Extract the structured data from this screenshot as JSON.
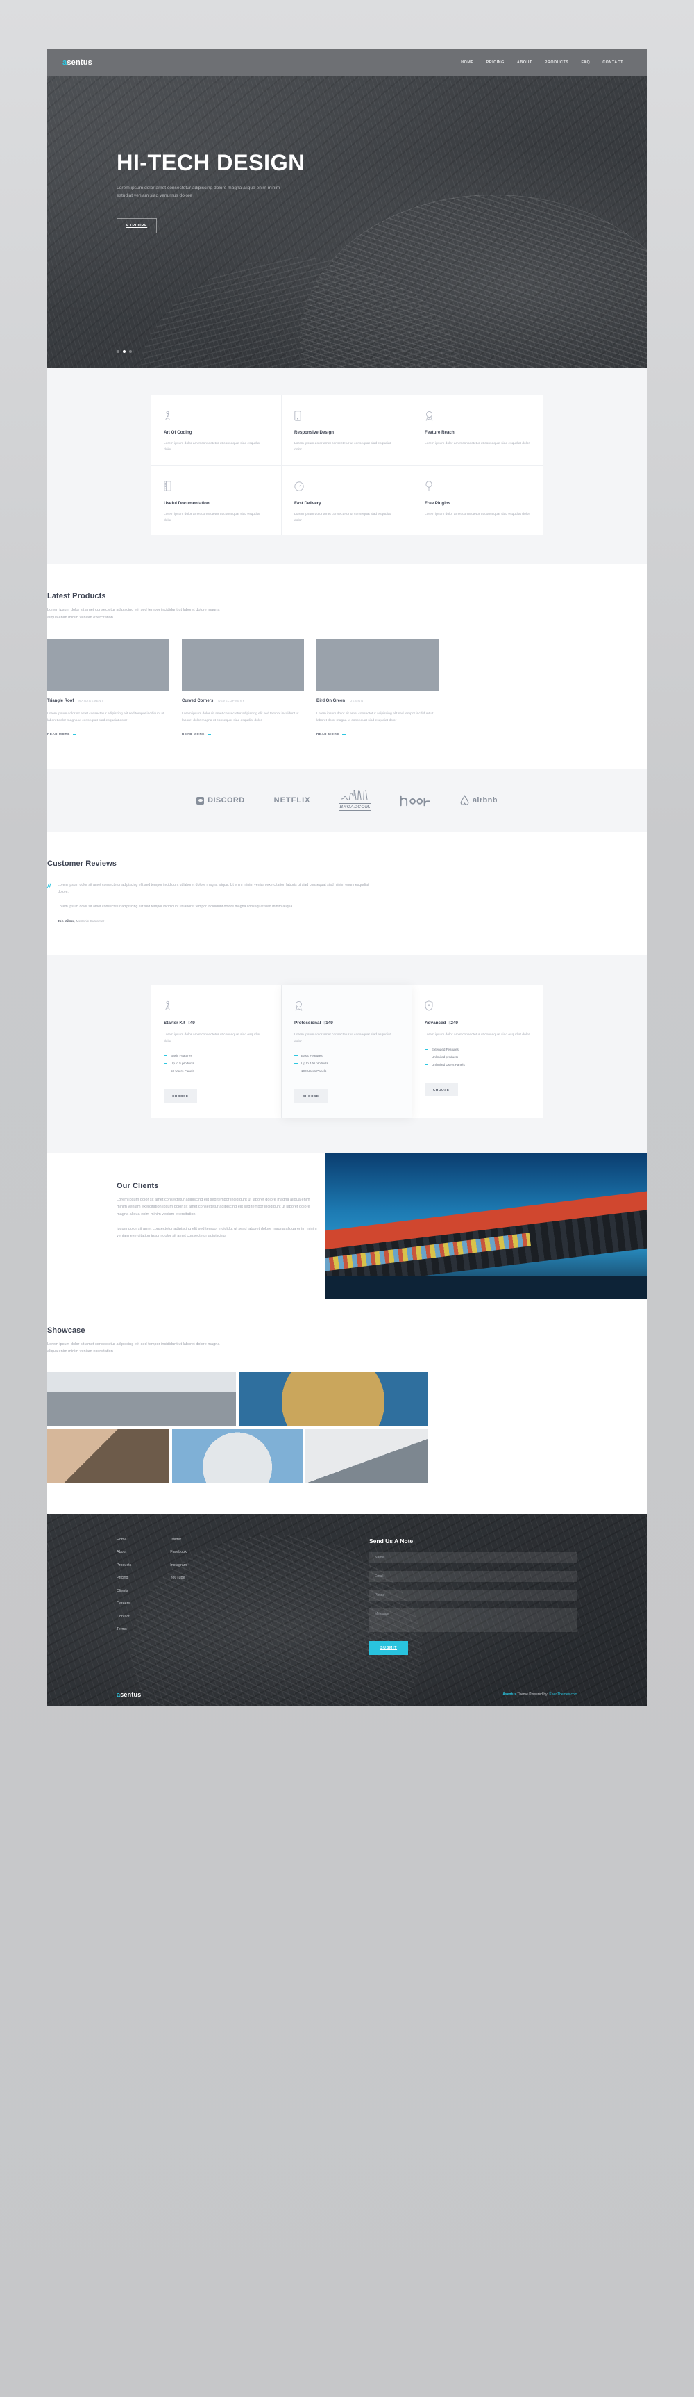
{
  "brand": {
    "prefix": "a",
    "name": "sentus",
    "accent": "#2ec6e0"
  },
  "nav": {
    "items": [
      "HOME",
      "PRICING",
      "ABOUT",
      "PRODUCTS",
      "FAQ",
      "CONTACT"
    ]
  },
  "hero": {
    "title": "HI-TECH DESIGN",
    "desc": "Lorem ipsum dolor amet consectetur adipiscing dolore magna aliqua enim minim estudiat veniam siad venumus dolore",
    "cta": "EXPLORE"
  },
  "features": [
    {
      "icon": "chess-pawn-icon",
      "title": "Art Of Coding",
      "desc": "Lorem ipsum dolor amet consectetur ut consequat siad esqudiat dolor"
    },
    {
      "icon": "mobile-icon",
      "title": "Responsive Design",
      "desc": "Lorem ipsum dolor amet consectetur ut consequat siad esqudiat dolor"
    },
    {
      "icon": "award-icon",
      "title": "Feature Reach",
      "desc": "Lorem ipsum dolor amet consectetur ut consequat siad esqudiat dolor"
    },
    {
      "icon": "book-icon",
      "title": "Useful Documentation",
      "desc": "Lorem ipsum dolor amet consectetur ut consequat siad esqudiat dolor"
    },
    {
      "icon": "speedometer-icon",
      "title": "Fast Delivery",
      "desc": "Lorem ipsum dolor amet consectetur ut consequat siad esqudiat dolor"
    },
    {
      "icon": "plug-icon",
      "title": "Free Plugins",
      "desc": "Lorem ipsum dolor amet consectetur ut consequat siad esqudiat dolor"
    }
  ],
  "products_section": {
    "title": "Latest Products",
    "sub": "Lorem ipsum dolor sit amet consectetur adipiscing elit sed tempor incididunt ut laboret dolore magna aliqua enim minim veniam exercitation",
    "read_more": "READ MORE",
    "items": [
      {
        "title": "Triangle Roof",
        "cat": "MANAGEMENT",
        "desc": "Lorem ipsum dolor sit amet consectetur adipiscing elit sed tempor incdidunt ut laboret dolor magna ut consequat siad esqudiat dolor"
      },
      {
        "title": "Curved Corners",
        "cat": "DEVELOPMENY",
        "desc": "Lorem ipsum dolor sit amet consectetur adipiscing elit sed tempor incdidunt ut laboret dolor magna ut consequat siad esqudiat dolor"
      },
      {
        "title": "Bird On Green",
        "cat": "DESIGN",
        "desc": "Lorem ipsum dolor sit amet consectetur adipiscing elit sed tempor incdidunt ut laboret dolor magna ut consequat siad esqudiat dolor"
      }
    ]
  },
  "brands": [
    "DISCORD",
    "NETFLIX",
    "BROADCOM.",
    "hoop",
    "airbnb"
  ],
  "reviews": {
    "title": "Customer Reviews",
    "p1": "Lorem ipsum dolor sit amet consectetur adipiscing elit sed tempor incididunt ut laboret dolore magna aliqua. Ut enim minim veniam exercitation laboris ut siad consequat siad minim enum esqudiat dolore.",
    "p2": "Lorem ipsum dolor sit amet consectetur adipiscing elit sed tempor incididunt ut laboret tempor incididunt dolore magna consequat siad minim aliqua.",
    "author": "Joh Milner",
    "author_role": ", Metronic Customer"
  },
  "pricing": {
    "choose": "CHOOSE",
    "currency": "$",
    "plans": [
      {
        "icon": "chess-pawn-icon",
        "name": "Starter Kit",
        "price": "49",
        "desc": "Lorem ipsum dolor amet consectetur ut consequat siad esqudiat dolor",
        "features": [
          "Basic Features",
          "Up to 5 products",
          "50 Users Panels"
        ]
      },
      {
        "icon": "award-icon",
        "name": "Professional",
        "price": "149",
        "desc": "Lorem ipsum dolor amet consectetur ut consequat siad esqudiat dolor",
        "features": [
          "Basic Features",
          "Up to 100 products",
          "100 Users Panels"
        ]
      },
      {
        "icon": "shield-icon",
        "name": "Advanced",
        "price": "249",
        "desc": "Lorem ipsum dolor amet consectetur ut consequat siad esqudiat dolor",
        "features": [
          "Extended Features",
          "Unlimited products",
          "Unlimited Users Panels"
        ]
      }
    ]
  },
  "clients": {
    "title": "Our Clients",
    "p1": "Lorem ipsum dolor sit amet consectetur adipiscing elit sed tempor incididunt ut laboret dolore magna aliqua enim minim veniam exercitation ipsum dolor sit amet consectetur adipiscing elit sed tempor incididunt ut laboret dolore magna aliqua enim minim veniam exercitation",
    "p2": "Ipsum dolor sit amet consectetur adipiscing elit sed tempor incididut ut sead laboret dolore magna aliqua enim minim veniam exercitation ipsum dolor sit amet consectetur adipiscing"
  },
  "showcase": {
    "title": "Showcase",
    "sub": "Lorem ipsum dolor sit amet consectetur adipiscing elit sed tempor incididunt ut laboret dolore magna aliqua enim minim veniam exercitation"
  },
  "footer": {
    "col1": [
      "Home",
      "About",
      "Products",
      "Pricing",
      "Clients",
      "Careers",
      "Contact",
      "Terms"
    ],
    "col2": [
      "Twitter",
      "Facebook",
      "Instagram",
      "YouTube"
    ],
    "form": {
      "title": "Send Us A Note",
      "name": "Name",
      "email": "Email",
      "phone": "Phone",
      "message": "Message",
      "submit": "SUBMIT"
    },
    "copyright_brand": "Asentus",
    "copyright_mid": " Theme Powered by: ",
    "copyright_link": "KeenThemes.com"
  }
}
